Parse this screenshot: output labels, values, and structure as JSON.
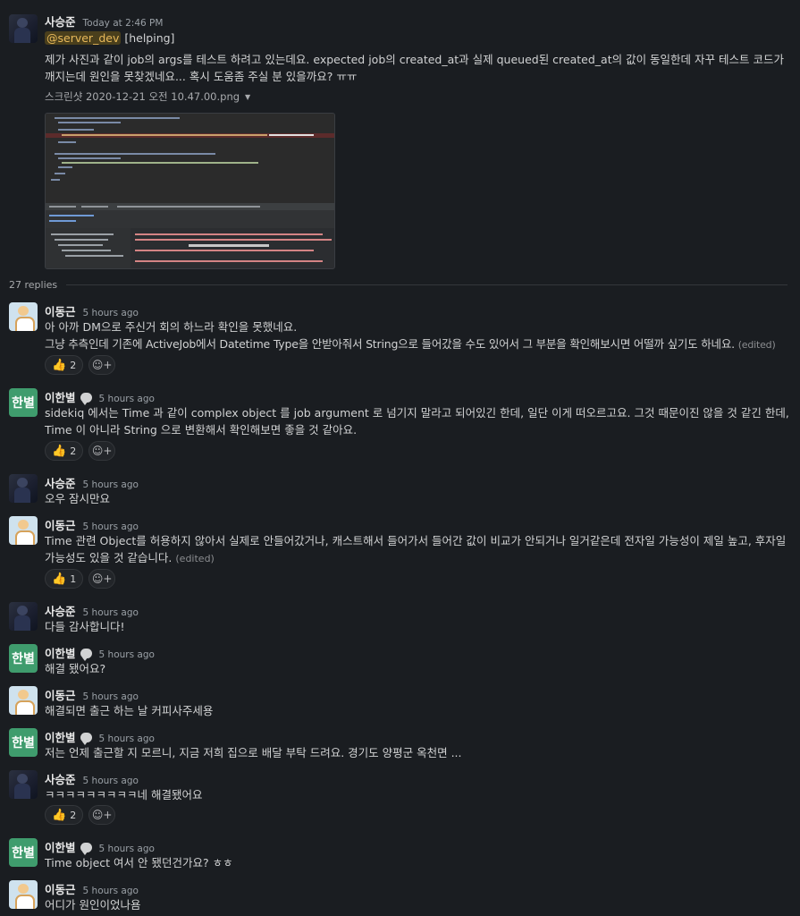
{
  "thread": {
    "root": {
      "author": "사승준",
      "time": "Today at 2:46 PM",
      "mention": "@server_dev",
      "tag": "[helping]",
      "text": "제가 사진과 같이 job의 args를 테스트 하려고 있는데요. expected job의 created_at과 실제 queued된 created_at의 값이 동일한데 자꾸 테스트 코드가 깨지는데 원인을 못찾겠네요... 혹시 도움좀 주실 분 있을까요? ㅠㅠ",
      "attachment_name": "스크린샷 2020-12-21 오전 10.47.00.png"
    },
    "replies_count": "27 replies",
    "messages": [
      {
        "author": "이동근",
        "time": "5 hours ago",
        "line1": "아 아까 DM으로 주신거 회의 하느라 확인을 못했네요.",
        "line2": "그냥 추측인데 기존에 ActiveJob에서 Datetime Type을 안받아줘서 String으로 들어갔을 수도 있어서 그 부분을 확인해보시면 어떨까 싶기도 하네요.",
        "edited": "(edited)",
        "reaction_count": "2"
      },
      {
        "author": "이한별",
        "time": "5 hours ago",
        "avatar_text": "한별",
        "text": "sidekiq 에서는 Time 과 같이 complex object 를 job argument 로 넘기지 말라고 되어있긴 한데, 일단 이게 떠오르고요. 그것 때문이진 않을 것 같긴 한데, Time 이 아니라 String 으로 변환해서 확인해보면 좋을 것 같아요.",
        "reaction_count": "2"
      },
      {
        "author": "사승준",
        "time": "5 hours ago",
        "text": "오우 잠시만요"
      },
      {
        "author": "이동근",
        "time": "5 hours ago",
        "text": "Time 관련 Object를 허용하지 않아서 실제로 안들어갔거나, 캐스트해서 들어가서 들어간 값이 비교가 안되거나 일거같은데 전자일 가능성이 제일 높고, 후자일 가능성도 있을 것 같습니다.",
        "edited": "(edited)",
        "reaction_count": "1"
      },
      {
        "author": "사승준",
        "time": "5 hours ago",
        "text": "다들 감사합니다!"
      },
      {
        "author": "이한별",
        "time": "5 hours ago",
        "avatar_text": "한별",
        "text": "해결 됐어요?"
      },
      {
        "author": "이동근",
        "time": "5 hours ago",
        "text": "해결되면 출근 하는 날 커피사주세용"
      },
      {
        "author": "이한별",
        "time": "5 hours ago",
        "avatar_text": "한별",
        "text": "저는 언제 출근할 지 모르니, 지금 저희 집으로 배달 부탁 드려요. 경기도 양평군 옥천면 ..."
      },
      {
        "author": "사승준",
        "time": "5 hours ago",
        "text": "ㅋㅋㅋㅋㅋㅋㅋㅋㅋ네 해결됐어요",
        "reaction_count": "2"
      },
      {
        "author": "이한별",
        "time": "5 hours ago",
        "avatar_text": "한별",
        "text": "Time object 여서 안 됐던건가요? ㅎㅎ"
      },
      {
        "author": "이동근",
        "time": "5 hours ago",
        "text": "어디가 원인이었나욤"
      }
    ]
  },
  "icons": {
    "reaction_emoji": "thumbs-up-icon",
    "add_reaction": "add-reaction-icon",
    "status": "speech-bubble-icon",
    "caret": "caret-down-icon"
  },
  "colors": {
    "background": "#1a1d21",
    "mention_bg": "#4a3f1c",
    "mention_fg": "#e8b95a",
    "han_avatar": "#3f9c6d"
  }
}
